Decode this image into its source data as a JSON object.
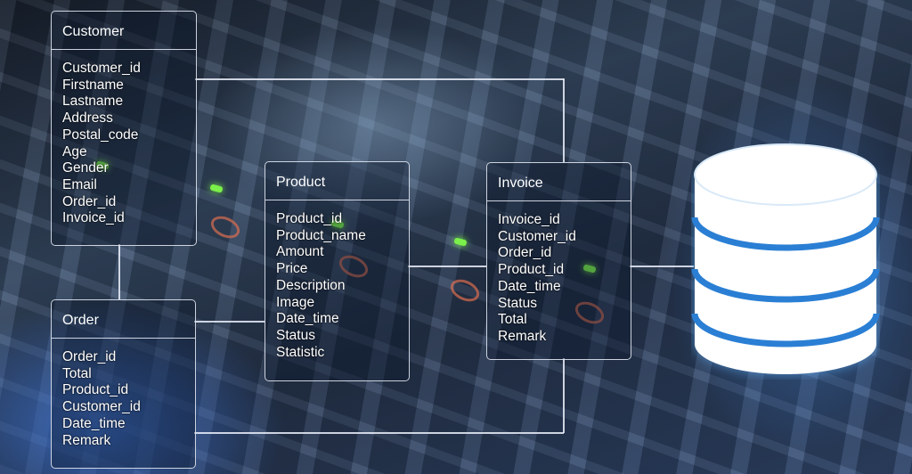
{
  "tables": [
    {
      "title": "Customer",
      "fields": [
        "Customer_id",
        "Firstname",
        "Lastname",
        "Address",
        "Postal_code",
        "Age",
        "Gender",
        "Email",
        "Order_id",
        "Invoice_id"
      ]
    },
    {
      "title": "Product",
      "fields": [
        "Product_id",
        "Product_name",
        "Amount",
        "Price",
        "Description",
        "Image",
        "Date_time",
        "Status",
        "Statistic"
      ]
    },
    {
      "title": "Invoice",
      "fields": [
        "Invoice_id",
        "Customer_id",
        "Order_id",
        "Product_id",
        "Date_time",
        "Status",
        "Total",
        "Remark"
      ]
    },
    {
      "title": "Order",
      "fields": [
        "Order_id",
        "Total",
        "Product_id",
        "Customer_id",
        "Date_time",
        "Remark"
      ]
    }
  ],
  "colors": {
    "line": "#ebf0fa",
    "database_body": "#ffffff",
    "database_band": "#2a7fd4",
    "led": "#7cf04a"
  },
  "icons": {
    "database": "database-cylinder-icon"
  }
}
